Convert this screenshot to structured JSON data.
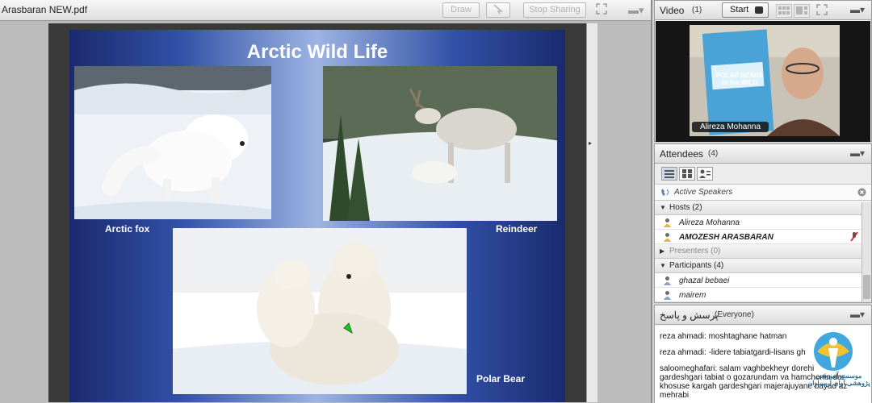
{
  "share": {
    "title": "Arasbaran NEW.pdf",
    "draw_label": "Draw",
    "stop_sharing_label": "Stop Sharing"
  },
  "slide": {
    "title": "Arctic Wild Life",
    "captions": {
      "arctic_fox": "Arctic fox",
      "reindeer": "Reindeer",
      "polar_bear": "Polar Bear"
    }
  },
  "video": {
    "title": "Video",
    "count": "(1)",
    "start_label": "Start",
    "name_tag": "Alireza Mohanna",
    "book_text": "POLAR BEARS in the WILD"
  },
  "attendees": {
    "title": "Attendees",
    "count": "(4)",
    "active_speakers": "Active Speakers",
    "groups": {
      "hosts": "Hosts (2)",
      "presenters": "Presenters (0)",
      "participants": "Participants (4)"
    },
    "hosts": [
      "Alireza Mohanna",
      "AMOZESH ARASBARAN"
    ],
    "participants": [
      "ghazal bebaei",
      "mairem"
    ]
  },
  "qa": {
    "title": "پرسش و پاسخ",
    "audience": "(Everyone)",
    "messages": [
      "reza ahmadi: moshtaghane hatman",
      "reza ahmadi: -lidere tabiatgardi-lisans gh",
      "saloomeghafari: salam vaghbekheyr dorehi gardeshgari tabiat o gozarundam va hamchenin dar khosuse kargah gardeshgari majerajuyane bayad az mehrabi"
    ]
  },
  "logo": {
    "text": "موسسه آموزشی پژوهشی آوای ارسباران"
  },
  "colors": {
    "slide_blue_dark": "#1b2a6e",
    "slide_blue_light": "#9db4e2",
    "logo_teal": "#2b9fd8",
    "logo_yellow": "#f2c230"
  }
}
